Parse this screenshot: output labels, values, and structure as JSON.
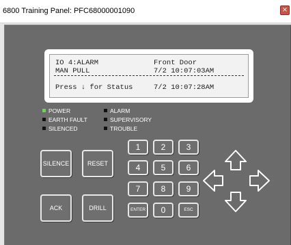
{
  "window": {
    "title": "6800 Training Panel: PFC68000001090",
    "close_symbol": "×"
  },
  "lcd": {
    "line1_left": "IO 4:ALARM",
    "line1_right": "Front Door",
    "line2_left": "MAN PULL",
    "line2_right": "7/2 10:07:03AM",
    "line3_left": "Press ↓ for Status",
    "line3_right": "7/2 10:07:28AM"
  },
  "indicators": [
    {
      "label": "POWER",
      "on": true
    },
    {
      "label": "ALARM",
      "on": false
    },
    {
      "label": "EARTH FAULT",
      "on": false
    },
    {
      "label": "SUPERVISORY",
      "on": false
    },
    {
      "label": "SILENCED",
      "on": false
    },
    {
      "label": "TROUBLE",
      "on": false
    }
  ],
  "buttons": {
    "silence": "SILENCE",
    "reset": "RESET",
    "ack": "ACK",
    "drill": "DRILL"
  },
  "keypad": {
    "k1": "1",
    "k2": "2",
    "k3": "3",
    "k4": "4",
    "k5": "5",
    "k6": "6",
    "k7": "7",
    "k8": "8",
    "k9": "9",
    "enter": "ENTER",
    "k0": "0",
    "esc": "ESC"
  },
  "colors": {
    "panel": "#6b6b6b",
    "led_on": "#6ed35a",
    "led_off": "#111111"
  },
  "icons": [
    "up-arrow-icon",
    "left-arrow-icon",
    "right-arrow-icon",
    "down-arrow-icon"
  ]
}
